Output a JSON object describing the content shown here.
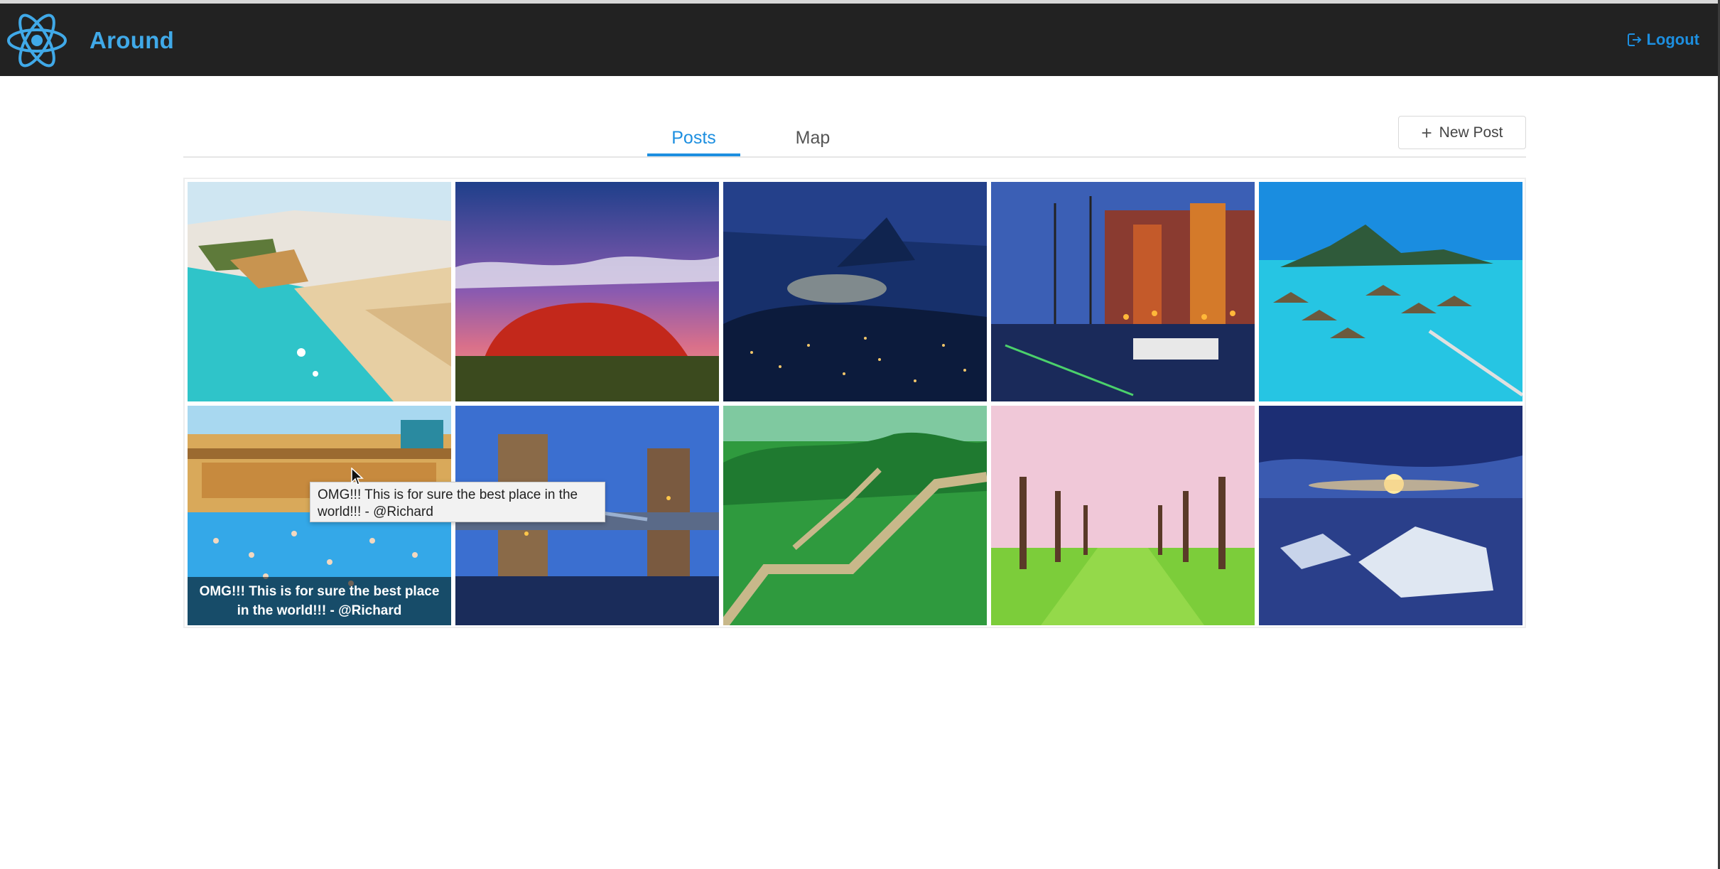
{
  "header": {
    "app_title": "Around",
    "logout_label": "Logout",
    "logo_icon": "react-atom-icon",
    "logout_icon": "logout-icon",
    "accent_color": "#40a9e8"
  },
  "tabs": [
    {
      "label": "Posts",
      "active": true
    },
    {
      "label": "Map",
      "active": false
    }
  ],
  "toolbar": {
    "new_post_label": "New Post",
    "new_post_icon": "plus-icon"
  },
  "gallery": {
    "tiles": [
      {
        "subject": "coastal-beach-town"
      },
      {
        "subject": "red-rock-monolith-sunset"
      },
      {
        "subject": "harbor-city-night-moon"
      },
      {
        "subject": "canal-harbor-dusk"
      },
      {
        "subject": "overwater-bungalows-lagoon"
      },
      {
        "subject": "thermal-bath-palace-pool",
        "caption": "OMG!!! This is for sure the best place in the world!!! - @Richard"
      },
      {
        "subject": "tower-bridge-dusk"
      },
      {
        "subject": "great-wall-green-hills"
      },
      {
        "subject": "cherry-blossom-avenue"
      },
      {
        "subject": "ice-shore-sunset"
      }
    ]
  },
  "tooltip": {
    "text": "OMG!!! This is for sure the best place in the world!!! - @Richard"
  }
}
